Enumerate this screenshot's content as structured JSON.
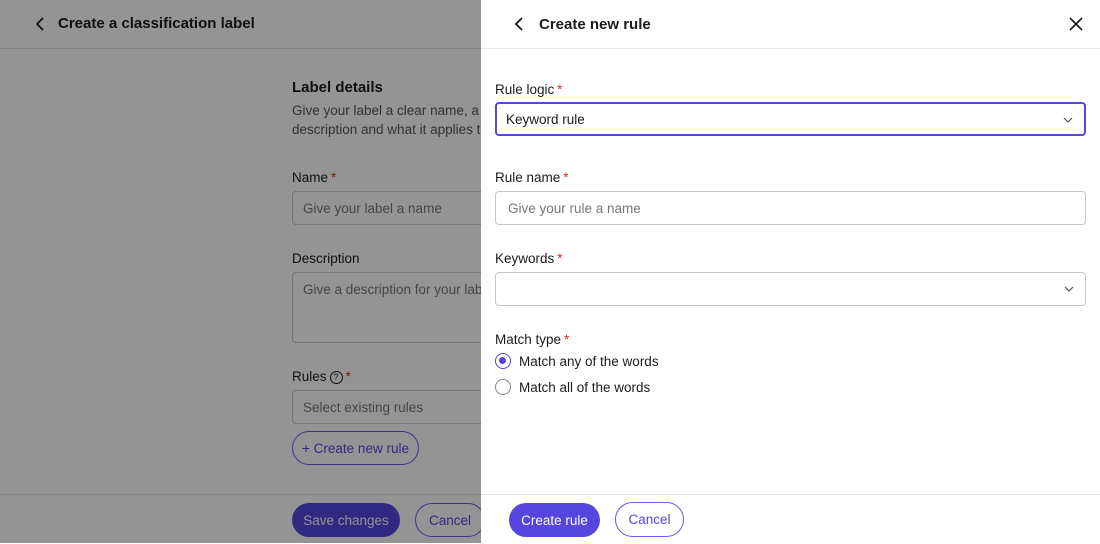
{
  "background": {
    "header_title": "Create a classification label",
    "section_title": "Label details",
    "section_desc": "Give your label a clear name, a description and what it applies to.",
    "name_label": "Name",
    "name_placeholder": "Give your label a name",
    "description_label": "Description",
    "description_placeholder": "Give a description for your label",
    "rules_label": "Rules",
    "rules_placeholder": "Select existing rules",
    "create_rule_link": "+ Create new rule",
    "save_label": "Save changes",
    "cancel_label": "Cancel",
    "required_mark": "*",
    "help_glyph": "?"
  },
  "drawer": {
    "title": "Create new rule",
    "rule_logic_label": "Rule logic",
    "rule_logic_value": "Keyword rule",
    "rule_name_label": "Rule name",
    "rule_name_placeholder": "Give your rule a name",
    "keywords_label": "Keywords",
    "keywords_value": "",
    "match_type_label": "Match type",
    "match_options": [
      {
        "label": "Match any of the words",
        "checked": true
      },
      {
        "label": "Match all of the words",
        "checked": false
      }
    ],
    "create_label": "Create rule",
    "cancel_label": "Cancel"
  },
  "icons": {
    "back": "chevron-left-icon",
    "close": "close-icon",
    "dropdown": "chevron-down-icon",
    "help": "help-circle-icon"
  },
  "colors": {
    "accent": "#5546e0",
    "required": "#d92d20",
    "overlay": "rgba(0,0,0,0.42)"
  }
}
